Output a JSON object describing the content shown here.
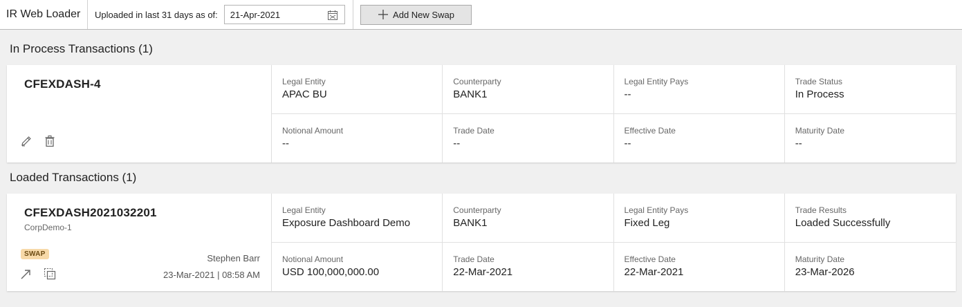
{
  "header": {
    "app_title": "IR Web Loader",
    "upload_label": "Uploaded in last 31 days as of:",
    "date_value": "21-Apr-2021",
    "add_button_label": "Add New Swap"
  },
  "in_process": {
    "title": "In Process Transactions (1)",
    "card": {
      "id": "CFEXDASH-4",
      "fields": [
        {
          "label": "Legal Entity",
          "value": "APAC BU"
        },
        {
          "label": "Counterparty",
          "value": "BANK1"
        },
        {
          "label": "Legal Entity Pays",
          "value": "--"
        },
        {
          "label": "Trade Status",
          "value": "In Process"
        },
        {
          "label": "Notional Amount",
          "value": "--"
        },
        {
          "label": "Trade Date",
          "value": "--"
        },
        {
          "label": "Effective Date",
          "value": "--"
        },
        {
          "label": "Maturity Date",
          "value": "--"
        }
      ]
    }
  },
  "loaded": {
    "title": "Loaded Transactions (1)",
    "card": {
      "id": "CFEXDASH2021032201",
      "subtitle": "CorpDemo-1",
      "badge": "SWAP",
      "user": "Stephen Barr",
      "timestamp": "23-Mar-2021 | 08:58 AM",
      "fields": [
        {
          "label": "Legal Entity",
          "value": "Exposure Dashboard Demo"
        },
        {
          "label": "Counterparty",
          "value": "BANK1"
        },
        {
          "label": "Legal Entity Pays",
          "value": "Fixed Leg"
        },
        {
          "label": "Trade Results",
          "value": "Loaded Successfully"
        },
        {
          "label": "Notional Amount",
          "value": "USD 100,000,000.00"
        },
        {
          "label": "Trade Date",
          "value": "22-Mar-2021"
        },
        {
          "label": "Effective Date",
          "value": "22-Mar-2021"
        },
        {
          "label": "Maturity Date",
          "value": "23-Mar-2026"
        }
      ]
    }
  },
  "icons": {
    "calendar": "calendar-icon",
    "plus": "plus-icon",
    "edit": "pencil-icon",
    "delete": "trash-icon",
    "open": "expand-arrow-icon",
    "copy": "copy-icon"
  },
  "colors": {
    "badge_bg": "#f7d9a8",
    "badge_text": "#6b4a12",
    "page_bg": "#f0f0f0",
    "button_bg": "#e4e4e4"
  }
}
